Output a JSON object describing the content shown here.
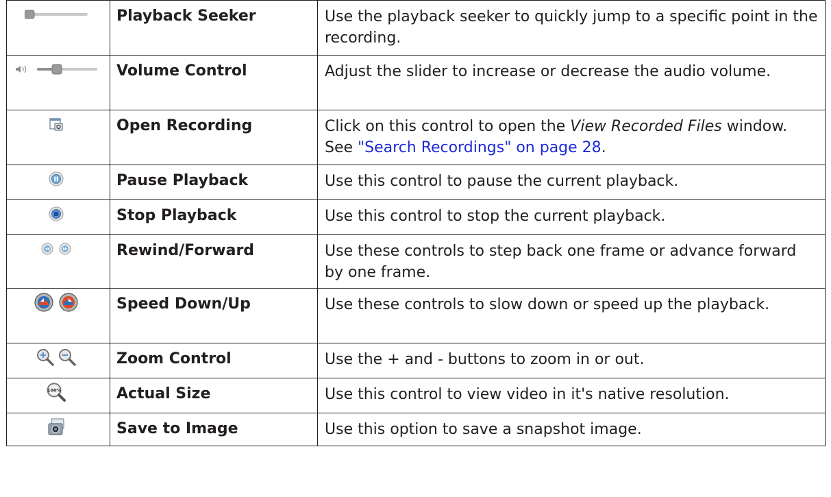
{
  "rows": [
    {
      "icons": [
        "seeker-slider-icon"
      ],
      "name": "Playback Seeker",
      "desc": "Use the playback seeker to quickly jump to a specific point in the recording."
    },
    {
      "icons": [
        "speaker-icon",
        "volume-slider-icon"
      ],
      "name": "Volume Control",
      "desc": "Adjust the slider to increase or decrease the audio volume."
    },
    {
      "icons": [
        "open-recording-icon"
      ],
      "name": "Open Recording",
      "desc_pre": "Click on this control to open the ",
      "desc_em": "View Recorded Files",
      "desc_mid": " window. See ",
      "desc_link": "\"Search Recordings\" on page 28",
      "desc_post": "."
    },
    {
      "icons": [
        "pause-icon"
      ],
      "name": "Pause Playback",
      "desc": "Use this control to pause the current playback."
    },
    {
      "icons": [
        "stop-icon"
      ],
      "name": "Stop Playback",
      "desc": "Use this control to stop the current playback."
    },
    {
      "icons": [
        "rewind-icon",
        "forward-icon"
      ],
      "name": "Rewind/Forward",
      "desc": "Use these controls to step back one frame or advance forward by one frame."
    },
    {
      "icons": [
        "speed-down-icon",
        "speed-up-icon"
      ],
      "name": "Speed  Down/Up",
      "desc": "Use these controls to slow down or speed up the playback."
    },
    {
      "icons": [
        "zoom-in-icon",
        "zoom-out-icon"
      ],
      "name": "Zoom Control",
      "desc": "Use the + and - buttons to zoom in or out."
    },
    {
      "icons": [
        "actual-size-icon"
      ],
      "name": "Actual Size",
      "icon_text": "100%",
      "desc": "Use this control to view video in it's native resolution."
    },
    {
      "icons": [
        "snapshot-camera-icon"
      ],
      "name": "Save to Image",
      "desc": "Use this option to save a snapshot image."
    }
  ],
  "colors": {
    "link": "#1f2bd6",
    "text": "#231f20",
    "border": "#231f20"
  }
}
